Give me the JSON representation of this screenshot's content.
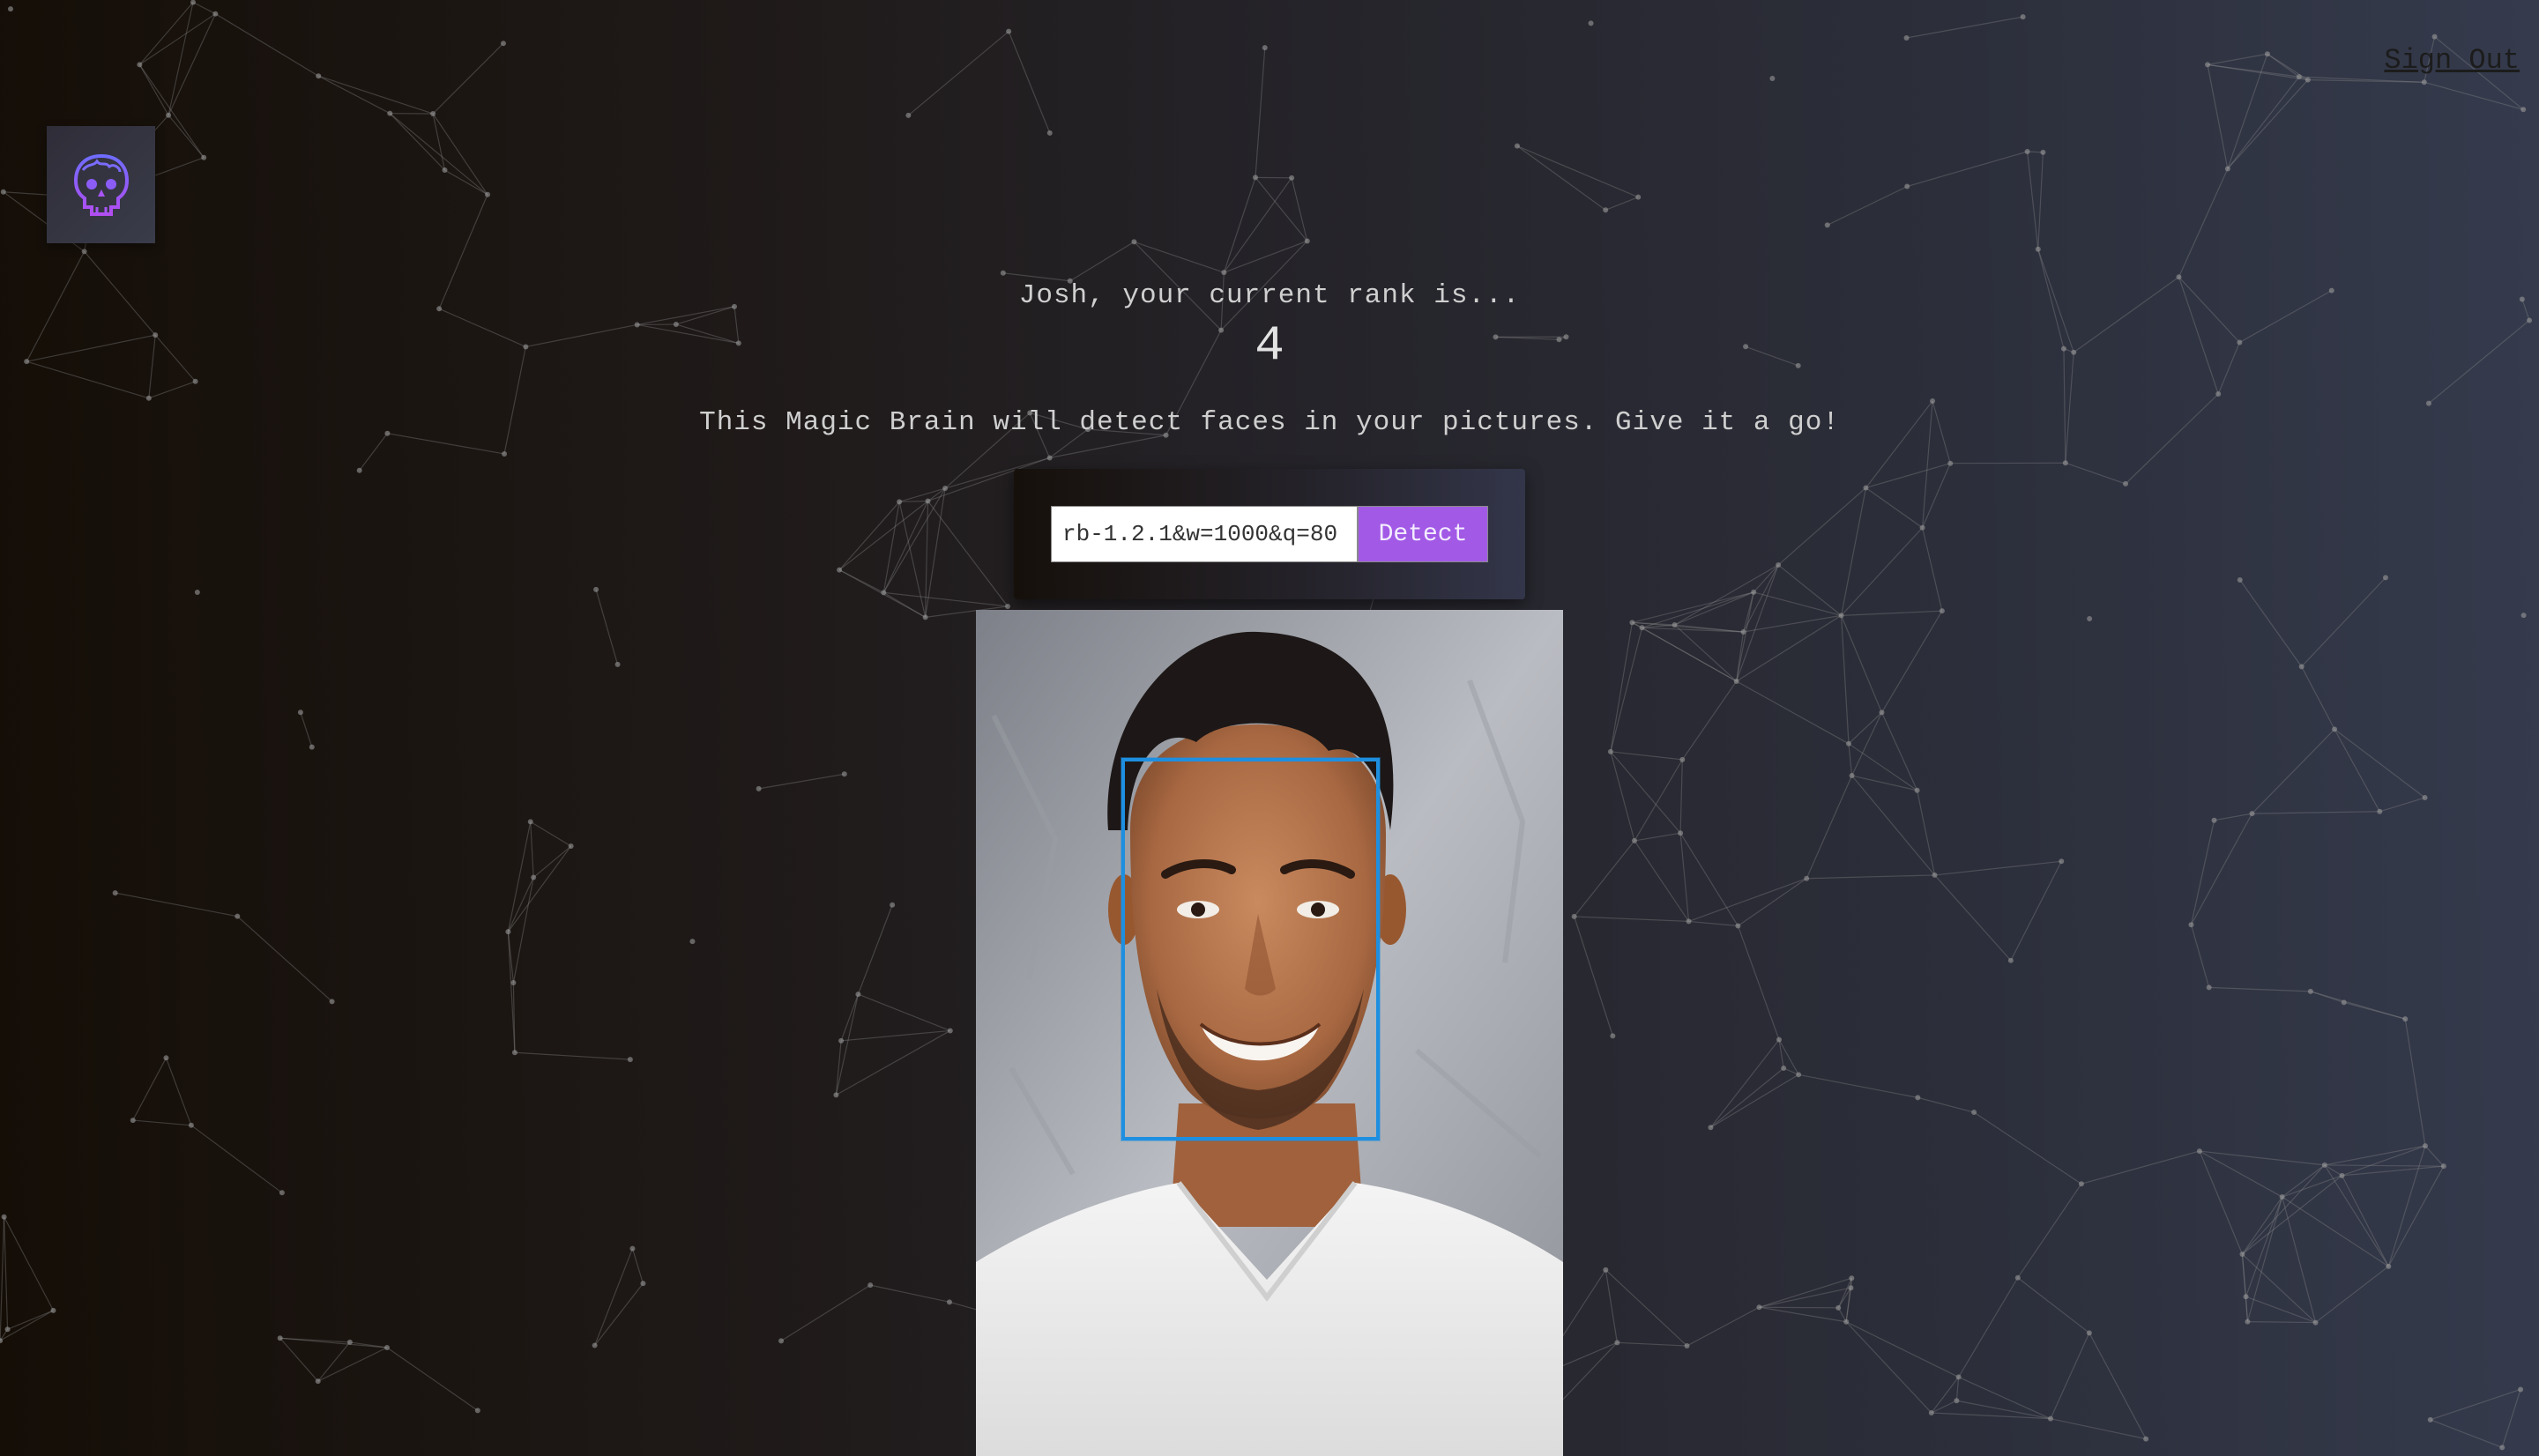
{
  "header": {
    "signout_label": "Sign Out",
    "logo_icon": "skull-brain-icon"
  },
  "rank": {
    "label": "Josh, your current rank is...",
    "value": "4"
  },
  "tagline": "This Magic Brain will detect faces in your pictures. Give it a go!",
  "form": {
    "input_value": "rb-1.2.1&w=1000&q=80",
    "button_label": "Detect"
  },
  "colors": {
    "accent": "#a259e6",
    "face_box": "#1e8fe0"
  }
}
